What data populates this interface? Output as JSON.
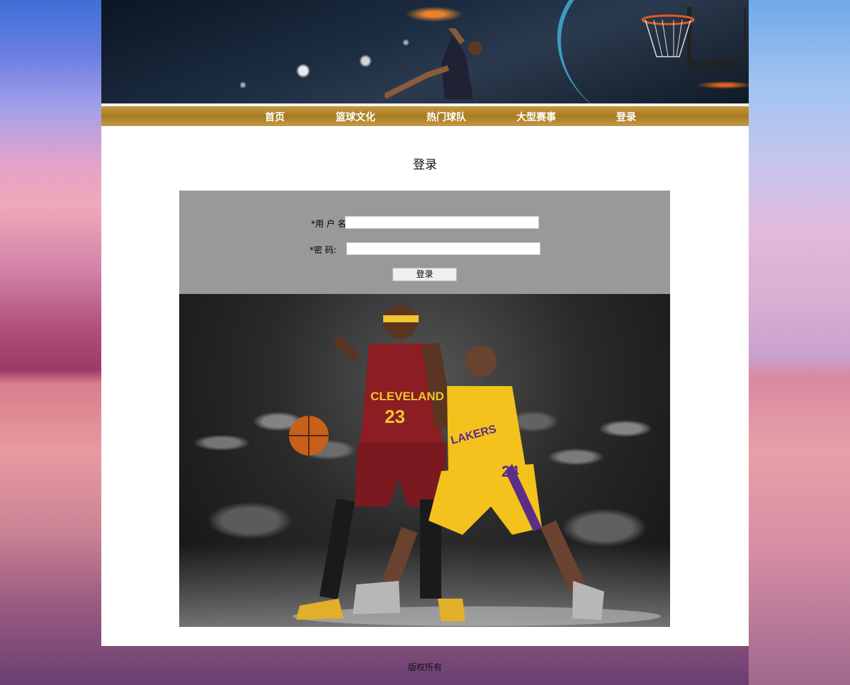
{
  "nav": {
    "items": [
      {
        "label": "首页"
      },
      {
        "label": "篮球文化"
      },
      {
        "label": "热门球队"
      },
      {
        "label": "大型赛事"
      },
      {
        "label": "登录"
      }
    ]
  },
  "page": {
    "title": "登录"
  },
  "form": {
    "username_label": "*用 户 名:",
    "username_value": "",
    "password_label": "*密    码:",
    "password_value": "",
    "submit_label": "登录"
  },
  "photo": {
    "jersey_left": "CLEVELAND",
    "number_left": "23",
    "jersey_right": "LAKERS",
    "number_right": "24"
  },
  "footer": {
    "text": "版权所有"
  },
  "colors": {
    "nav_bar": "#b8862e",
    "panel": "#999999",
    "container": "#ffffff"
  }
}
